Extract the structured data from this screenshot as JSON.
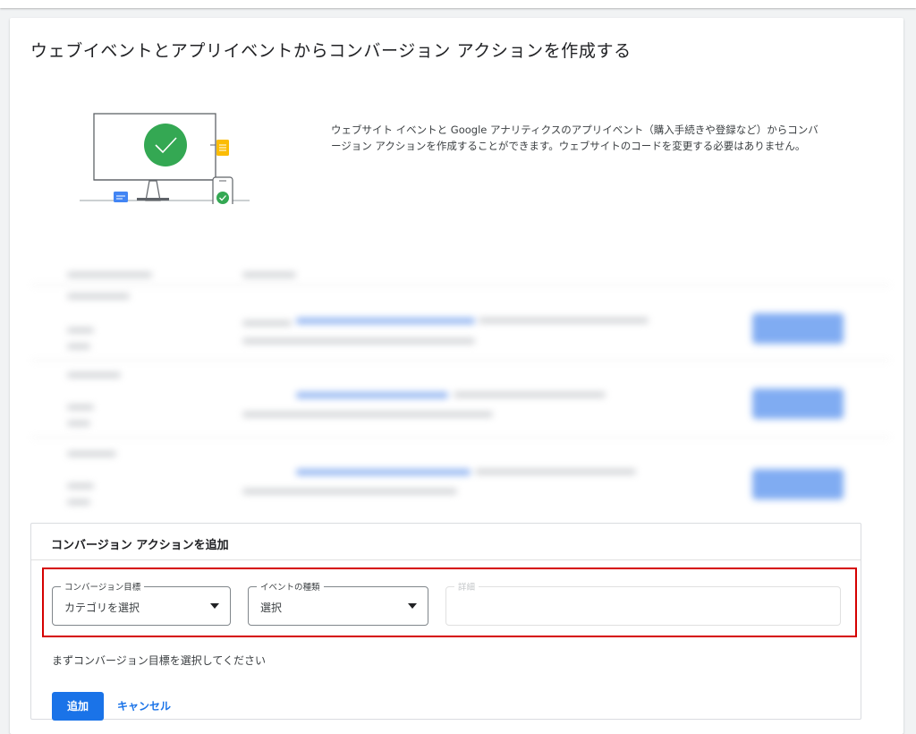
{
  "page": {
    "title": "ウェブイベントとアプリイベントからコンバージョン アクションを作成する",
    "description": "ウェブサイト イベントと Google アナリティクスのアプリイベント（購入手続きや登録など）からコンバージョン アクションを作成することができます。ウェブサイトのコードを変更する必要はありません。"
  },
  "illustration": {
    "icons": [
      "monitor-icon",
      "checkmark-circle-icon",
      "document-icon",
      "phone-icon",
      "chat-bubble-icon"
    ],
    "colors": {
      "check_green": "#34a853",
      "doc_yellow": "#fbbc04",
      "chat_blue": "#4285f4"
    }
  },
  "add_panel": {
    "title": "コンバージョン アクションを追加",
    "fields": [
      {
        "label": "コンバージョン目標",
        "value": "カテゴリを選択"
      },
      {
        "label": "イベントの種類",
        "value": "選択"
      },
      {
        "label": "詳細",
        "value": ""
      }
    ],
    "hint": "まずコンバージョン目標を選択してください",
    "add_label": "追加",
    "cancel_label": "キャンセル"
  },
  "colors": {
    "primary": "#1a73e8",
    "highlight": "#d50000"
  }
}
